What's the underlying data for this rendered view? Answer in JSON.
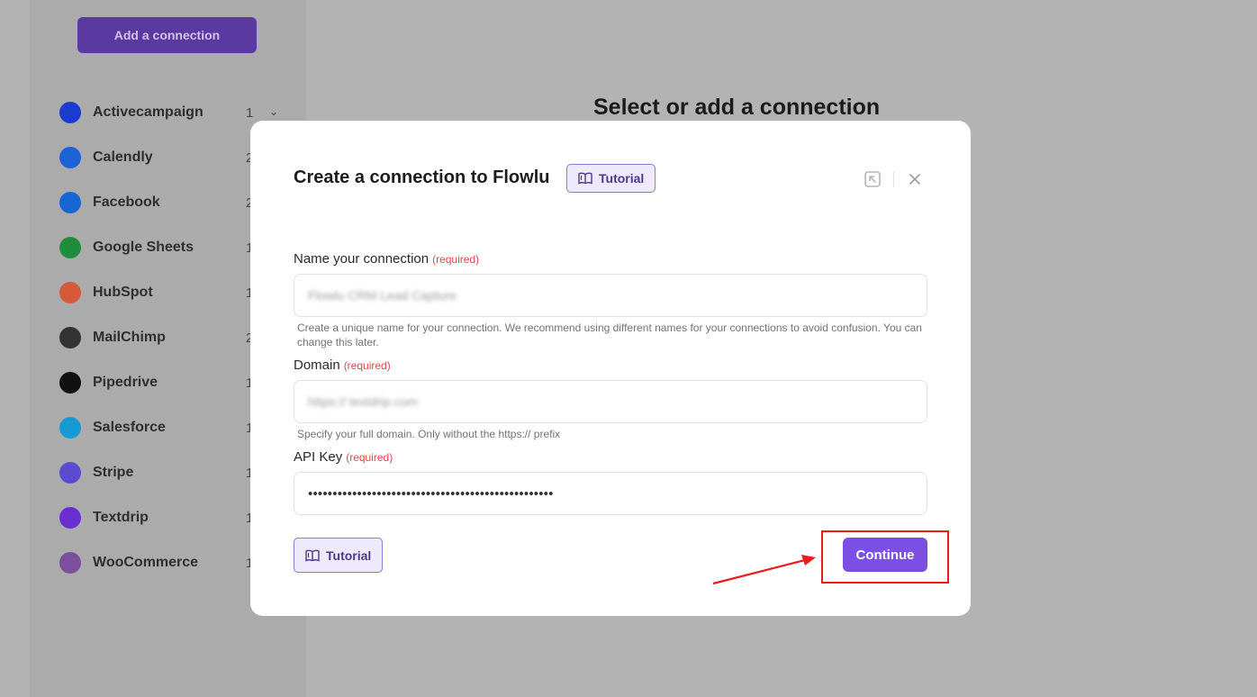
{
  "sidebar": {
    "add_connection_label": "Add a connection",
    "items": [
      {
        "label": "Activecampaign",
        "count": "1",
        "icon": "activecampaign-icon",
        "color": "#1a3bd0",
        "chevron": true
      },
      {
        "label": "Calendly",
        "count": "2",
        "icon": "calendly-icon",
        "color": "#1d63d6"
      },
      {
        "label": "Facebook",
        "count": "2",
        "icon": "facebook-icon",
        "color": "#1766d4"
      },
      {
        "label": "Google Sheets",
        "count": "1",
        "icon": "google-sheets-icon",
        "color": "#1e8e3e"
      },
      {
        "label": "HubSpot",
        "count": "1",
        "icon": "hubspot-icon",
        "color": "#d45a3a"
      },
      {
        "label": "MailChimp",
        "count": "2",
        "icon": "mailchimp-icon",
        "color": "#333333"
      },
      {
        "label": "Pipedrive",
        "count": "1",
        "icon": "pipedrive-icon",
        "color": "#111111"
      },
      {
        "label": "Salesforce",
        "count": "1",
        "icon": "salesforce-icon",
        "color": "#149bd4"
      },
      {
        "label": "Stripe",
        "count": "1",
        "icon": "stripe-icon",
        "color": "#5b4bd0"
      },
      {
        "label": "Textdrip",
        "count": "1",
        "icon": "textdrip-icon",
        "color": "#6a2fd0"
      },
      {
        "label": "WooCommerce",
        "count": "1",
        "icon": "woocommerce-icon",
        "color": "#7a4f9e"
      }
    ]
  },
  "main": {
    "title": "Select or add a connection"
  },
  "modal": {
    "title": "Create a connection to Flowlu",
    "tutorial_label": "Tutorial",
    "required_label": "(required)",
    "fields": {
      "name": {
        "label": "Name your connection",
        "value": "Flowlu CRM Lead Capture",
        "help": "Create a unique name for your connection. We recommend using different names for your connections to avoid confusion. You can change this later."
      },
      "domain": {
        "label": "Domain",
        "value": "https:// textdrip.com",
        "help": "Specify your full domain. Only without the https:// prefix"
      },
      "api_key": {
        "label": "API Key",
        "value": "••••••••••••••••••••••••••••••••••••••••••••••••••"
      }
    },
    "continue_label": "Continue"
  },
  "colors": {
    "accent": "#7b4fe3",
    "annotation": "#ea1c1c",
    "required": "#e0484a"
  }
}
